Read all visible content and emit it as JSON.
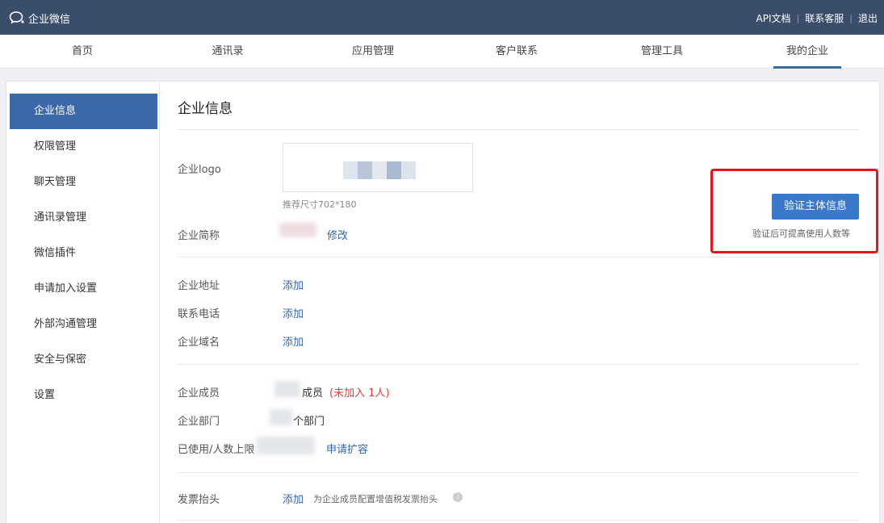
{
  "app": {
    "name": "企业微信"
  },
  "top_links": [
    {
      "label": "API文档"
    },
    {
      "label": "联系客服"
    },
    {
      "label": "退出"
    }
  ],
  "nav": [
    {
      "label": "首页",
      "active": false
    },
    {
      "label": "通讯录",
      "active": false
    },
    {
      "label": "应用管理",
      "active": false
    },
    {
      "label": "客户联系",
      "active": false
    },
    {
      "label": "管理工具",
      "active": false
    },
    {
      "label": "我的企业",
      "active": true
    }
  ],
  "sidebar": [
    {
      "label": "企业信息",
      "active": true
    },
    {
      "label": "权限管理"
    },
    {
      "label": "聊天管理"
    },
    {
      "label": "通讯录管理"
    },
    {
      "label": "微信插件"
    },
    {
      "label": "申请加入设置"
    },
    {
      "label": "外部沟通管理"
    },
    {
      "label": "安全与保密"
    },
    {
      "label": "设置"
    }
  ],
  "main": {
    "title": "企业信息",
    "logo": {
      "label": "企业logo",
      "hint": "推荐尺寸702*180"
    },
    "short_name": {
      "label": "企业简称",
      "action": "修改"
    },
    "verify": {
      "button": "验证主体信息",
      "note": "验证后可提高使用人数等"
    },
    "address": {
      "label": "企业地址",
      "action": "添加"
    },
    "phone": {
      "label": "联系电话",
      "action": "添加"
    },
    "domain": {
      "label": "企业域名",
      "action": "添加"
    },
    "members": {
      "label": "企业成员",
      "suffix": "成员",
      "pending": "(未加入 1人)"
    },
    "departments": {
      "label": "企业部门",
      "suffix": "个部门"
    },
    "usage": {
      "label": "已使用/人数上限",
      "action": "申请扩容"
    },
    "invoice": {
      "label": "发票抬头",
      "action": "添加",
      "desc": "为企业成员配置增值税发票抬头"
    }
  },
  "colors": {
    "topbar": "#3a4d6b",
    "accent": "#3a68a8",
    "button": "#3a78c9",
    "link": "#2f66b0",
    "highlight_box": "#e8141b"
  }
}
